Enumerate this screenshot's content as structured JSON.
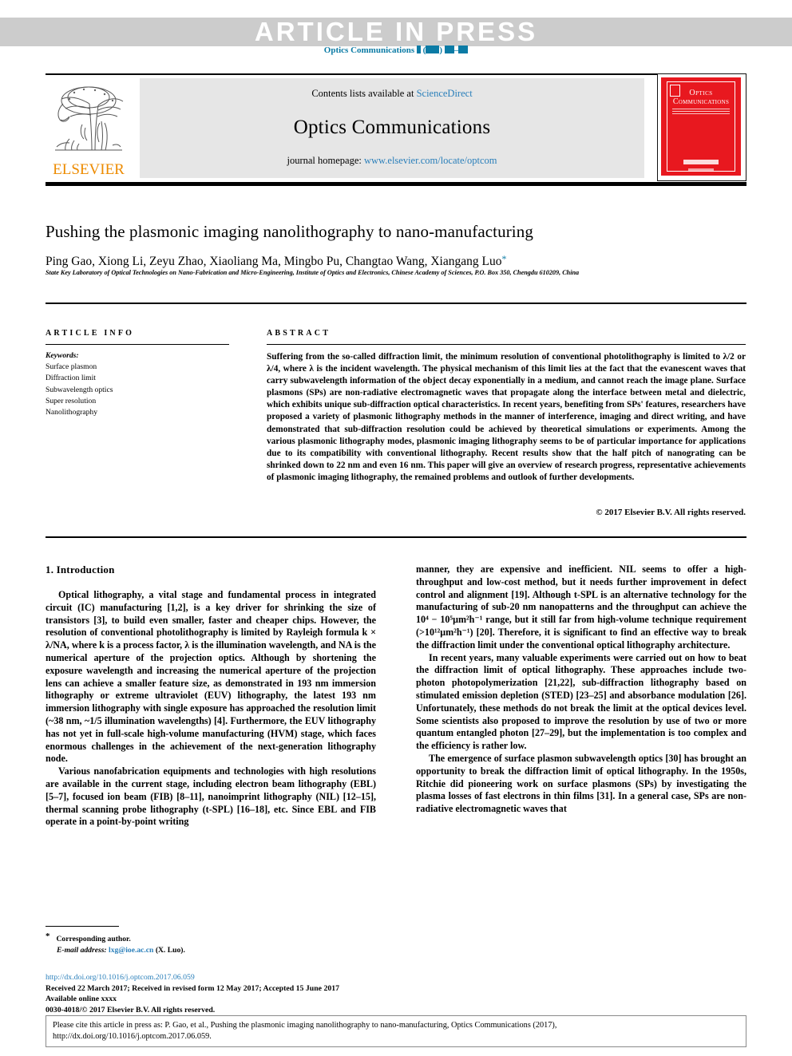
{
  "banner": {
    "article_in_press": "ARTICLE  IN  PRESS",
    "journal_ref_prefix": "Optics Communications"
  },
  "masthead": {
    "contents_prefix": "Contents lists available at ",
    "sciencedirect": "ScienceDirect",
    "journal_title": "Optics Communications",
    "homepage_label": "journal homepage: ",
    "homepage_url": "www.elsevier.com/locate/optcom",
    "publisher_wordmark": "ELSEVIER",
    "cover_title_line1": "Optics",
    "cover_title_line2": "Communications"
  },
  "article": {
    "title": "Pushing the plasmonic imaging nanolithography to nano-manufacturing",
    "authors": "Ping Gao, Xiong Li, Zeyu Zhao, Xiaoliang Ma, Mingbo Pu, Changtao Wang, Xiangang Luo",
    "corresponding_marker": "*",
    "affiliation": "State Key Laboratory of Optical Technologies on Nano-Fabrication and Micro-Engineering, Institute of Optics and Electronics, Chinese Academy of Sciences, P.O. Box 350, Chengdu 610209, China"
  },
  "info": {
    "article_info_heading": "ARTICLE INFO",
    "abstract_heading": "ABSTRACT",
    "keywords_label": "Keywords:",
    "keywords": [
      "Surface plasmon",
      "Diffraction limit",
      "Subwavelength optics",
      "Super resolution",
      "Nanolithography"
    ]
  },
  "abstract": {
    "text": "Suffering from the so-called diffraction limit, the minimum resolution of conventional photolithography is limited to λ/2 or λ/4, where λ is the incident wavelength. The physical mechanism of this limit lies at the fact that the evanescent waves that carry subwavelength information of the object decay exponentially in a medium, and cannot reach the image plane. Surface plasmons (SPs) are non-radiative electromagnetic waves that propagate along the interface between metal and dielectric, which exhibits unique sub-diffraction optical characteristics. In recent years, benefiting from SPs' features, researchers have proposed a variety of plasmonic lithography methods in the manner of interference, imaging and direct writing, and have demonstrated that sub-diffraction resolution could be achieved by theoretical simulations or experiments. Among the various plasmonic lithography modes, plasmonic imaging lithography seems to be of particular importance for applications due to its compatibility with conventional lithography. Recent results show that the half pitch of nanograting can be shrinked down to 22 nm and even 16 nm. This paper will give an overview of research progress, representative achievements of plasmonic imaging lithography, the remained problems and outlook of further developments.",
    "copyright": "© 2017 Elsevier B.V. All rights reserved."
  },
  "body": {
    "section_heading": "1.  Introduction",
    "left_paragraphs": [
      "Optical lithography, a vital stage and fundamental process in integrated circuit (IC) manufacturing [1,2], is a key driver for shrinking the size of transistors [3], to build even smaller, faster and cheaper chips. However, the resolution of conventional photolithography is limited by Rayleigh formula k × λ/NA, where k is a process factor, λ is the illumination wavelength, and NA is the numerical aperture of the projection optics. Although by shortening the exposure wavelength and increasing the numerical aperture of the projection lens can achieve a smaller feature size, as demonstrated in 193 nm immersion lithography or extreme ultraviolet (EUV) lithography, the latest 193 nm immersion lithography with single exposure has approached the resolution limit (~38 nm, ~1/5 illumination wavelengths) [4]. Furthermore, the EUV lithography has not yet in full-scale high-volume manufacturing (HVM) stage, which faces enormous challenges in the achievement of the next-generation lithography node.",
      "Various nanofabrication equipments and technologies with high resolutions are available in the current stage, including electron beam lithography (EBL) [5–7], focused ion beam (FIB) [8–11], nanoimprint lithography (NIL) [12–15], thermal scanning probe lithography (t-SPL) [16–18], etc. Since EBL and FIB operate in a point-by-point writing"
    ],
    "right_paragraphs": [
      "manner, they are expensive and inefficient. NIL seems to offer a high-throughput and low-cost method, but it needs further improvement in defect control and alignment [19]. Although t-SPL is an alternative technology for the manufacturing of sub-20 nm nanopatterns and the throughput can achieve the 10⁴ − 10⁵μm²h⁻¹ range, but it still far from high-volume technique requirement (>10¹²μm²h⁻¹) [20]. Therefore, it is significant to find an effective way to break the diffraction limit under the conventional optical lithography architecture.",
      "In recent years, many valuable experiments were carried out on how to beat the diffraction limit of optical lithography. These approaches include two-photon photopolymerization [21,22], sub-diffraction lithography based on stimulated emission depletion (STED) [23–25] and absorbance modulation [26]. Unfortunately, these methods do not break the limit at the optical devices level. Some scientists also proposed to improve the resolution by use of two or more quantum entangled photon [27–29], but the implementation is too complex and the efficiency is rather low.",
      "The emergence of surface plasmon subwavelength optics [30] has brought an opportunity to break the diffraction limit of optical lithography. In the 1950s, Ritchie did pioneering work on surface plasmons (SPs) by investigating the plasma losses of fast electrons in thin films [31]. In a general case, SPs are non-radiative electromagnetic waves that"
    ]
  },
  "footnote": {
    "corresponding": "Corresponding author.",
    "email_label": "E-mail address:",
    "email": "lxg@ioe.ac.cn",
    "email_owner": "(X. Luo)."
  },
  "publication": {
    "doi": "http://dx.doi.org/10.1016/j.optcom.2017.06.059",
    "dates": "Received 22 March 2017; Received in revised form 12 May 2017; Accepted 15 June 2017",
    "available": "Available online xxxx",
    "issn_copyright": "0030-4018/© 2017 Elsevier B.V. All rights reserved."
  },
  "citation_footer": {
    "line1": "Please cite this article in press as: P. Gao, et al., Pushing the plasmonic imaging nanolithography to nano-manufacturing, Optics Communications (2017),",
    "line2": "http://dx.doi.org/10.1016/j.optcom.2017.06.059."
  },
  "colors": {
    "banner_gray": "#cccccc",
    "link_blue": "#2a7fba",
    "ref_blue": "#2a8fc4",
    "elsevier_orange": "#ED8B00",
    "cover_red": "#e8181f",
    "masthead_gray": "#e6e6e6"
  }
}
